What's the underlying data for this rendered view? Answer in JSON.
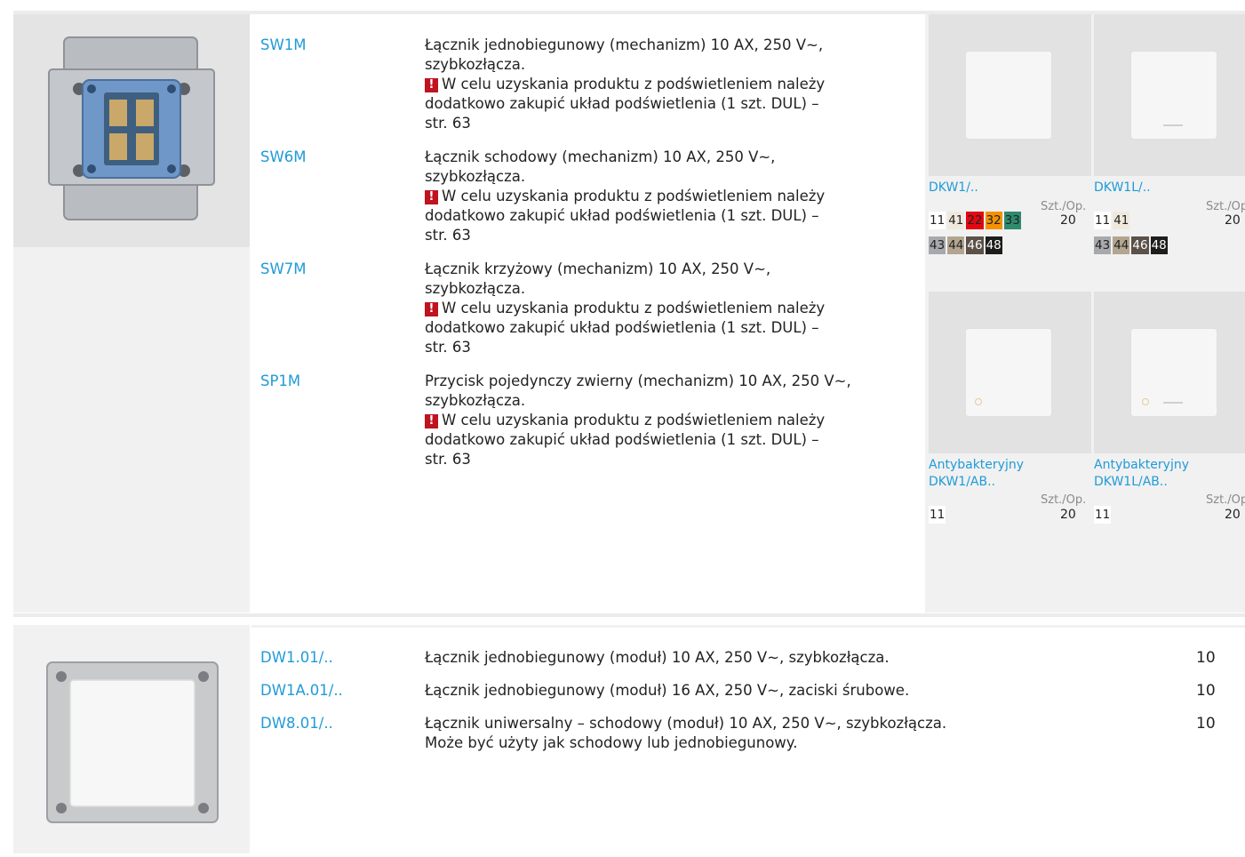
{
  "section1": {
    "products": [
      {
        "code": "SW1M",
        "lines": [
          "Łącznik jednobiegunowy (mechanizm) 10 AX, 250 V∼,",
          "szybkozłącza."
        ],
        "note": [
          "W celu uzyskania produktu z podświetleniem należy",
          "dodatkowo zakupić układ podświetlenia (1 szt. DUL) –",
          "str. 63"
        ]
      },
      {
        "code": "SW6M",
        "lines": [
          "Łącznik schodowy (mechanizm) 10 AX, 250 V∼,",
          "szybkozłącza."
        ],
        "note": [
          "W celu uzyskania produktu z podświetleniem należy",
          "dodatkowo zakupić układ podświetlenia (1 szt. DUL) –",
          "str. 63"
        ]
      },
      {
        "code": "SW7M",
        "lines": [
          "Łącznik krzyżowy (mechanizm) 10 AX, 250 V∼,",
          "szybkozłącza."
        ],
        "note": [
          "W celu uzyskania produktu z podświetleniem należy",
          "dodatkowo zakupić układ podświetlenia (1 szt. DUL) –",
          "str. 63"
        ]
      },
      {
        "code": "SP1M",
        "lines": [
          "Przycisk pojedynczy zwierny (mechanizm) 10 AX, 250 V∼,",
          "szybkozłącza."
        ],
        "note": [
          "W celu uzyskania produktu z podświetleniem należy",
          "dodatkowo zakupić układ podświetlenia (1 szt. DUL) –",
          "str. 63"
        ]
      }
    ],
    "warn_symbol": "!",
    "accessories": [
      {
        "name_lines": [
          "DKW1/.."
        ],
        "szt_label": "Szt./Op.",
        "qty": "20",
        "colors": [
          [
            "11",
            "41",
            "22",
            "32",
            "33"
          ],
          [
            "43",
            "44",
            "46",
            "48"
          ]
        ]
      },
      {
        "name_lines": [
          "DKW1L/.."
        ],
        "szt_label": "Szt./Op.",
        "qty": "20",
        "colors": [
          [
            "11",
            "41"
          ],
          [
            "43",
            "44",
            "46",
            "48"
          ]
        ]
      },
      {
        "name_lines": [
          "Antybakteryjny",
          "DKW1/AB.."
        ],
        "szt_label": "Szt./Op.",
        "qty": "20",
        "colors": [
          [
            "11"
          ]
        ]
      },
      {
        "name_lines": [
          "Antybakteryjny",
          "DKW1L/AB.."
        ],
        "szt_label": "Szt./Op.",
        "qty": "20",
        "colors": [
          [
            "11"
          ]
        ]
      }
    ]
  },
  "section2": {
    "products": [
      {
        "code": "DW1.01/..",
        "lines": [
          "Łącznik jednobiegunowy (moduł) 10 AX, 250 V∼, szybkozłącza."
        ],
        "qty": "10"
      },
      {
        "code": "DW1A.01/..",
        "lines": [
          "Łącznik jednobiegunowy (moduł) 16 AX, 250 V∼, zaciski śrubowe."
        ],
        "qty": "10"
      },
      {
        "code": "DW8.01/..",
        "lines": [
          "Łącznik uniwersalny – schodowy (moduł) 10 AX, 250 V∼, szybkozłącza.",
          "Może być użyty jak schodowy lub jednobiegunowy."
        ],
        "qty": "10"
      }
    ]
  },
  "color_chips": {
    "11": {
      "bg": "#ffffff",
      "fg": "#222222"
    },
    "41": {
      "bg": "#efe9dd",
      "fg": "#222222"
    },
    "22": {
      "bg": "#e30613",
      "fg": "#222222"
    },
    "32": {
      "bg": "#f39200",
      "fg": "#222222"
    },
    "33": {
      "bg": "#2e8b6e",
      "fg": "#222222"
    },
    "43": {
      "bg": "#a7a9ac",
      "fg": "#222222"
    },
    "44": {
      "bg": "#b3a58f",
      "fg": "#222222"
    },
    "46": {
      "bg": "#5b5149",
      "fg": "#ffffff"
    },
    "48": {
      "bg": "#1d1d1b",
      "fg": "#ffffff"
    }
  }
}
